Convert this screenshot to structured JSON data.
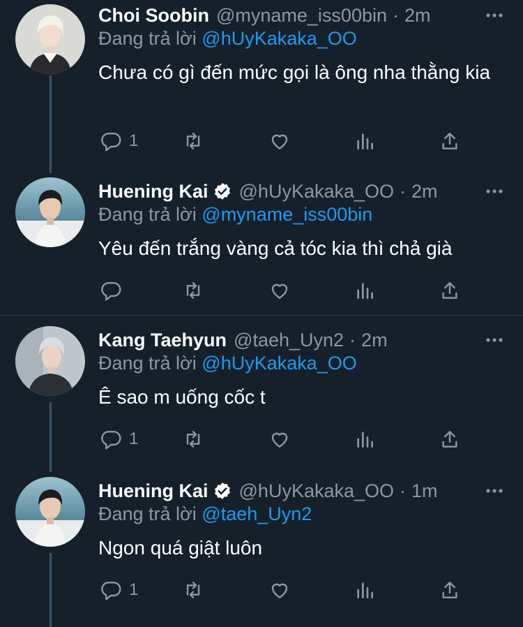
{
  "tweets": [
    {
      "name": "Choi Soobin",
      "verified": false,
      "handle": "@myname_iss00bin",
      "time": "2m",
      "reply_prefix": "Đang trả lời",
      "reply_to": "@hUyKakaka_OO",
      "text": "Chưa có gì đến mức gọi là ông nha thằng kia",
      "reply_count": "1",
      "avatar": "soobin-avatar"
    },
    {
      "name": "Huening Kai",
      "verified": true,
      "handle": "@hUyKakaka_OO",
      "time": "2m",
      "reply_prefix": "Đang trả lời",
      "reply_to": "@myname_iss00bin",
      "text": "Yêu đến trắng vàng cả tóc kia thì chả già",
      "reply_count": "",
      "avatar": "kai-avatar"
    },
    {
      "name": "Kang Taehyun",
      "verified": false,
      "handle": "@taeh_Uyn2",
      "time": "2m",
      "reply_prefix": "Đang trả lời",
      "reply_to": "@hUyKakaka_OO",
      "text": "Ê sao m uống cốc t",
      "reply_count": "1",
      "avatar": "taehyun-avatar"
    },
    {
      "name": "Huening Kai",
      "verified": true,
      "handle": "@hUyKakaka_OO",
      "time": "1m",
      "reply_prefix": "Đang trả lời",
      "reply_to": "@taeh_Uyn2",
      "text": "Ngon quá giật luôn",
      "reply_count": "1",
      "avatar": "kai-avatar"
    }
  ],
  "separator": "·",
  "colors": {
    "background": "#15202b",
    "secondary_text": "#8b98a5",
    "mention": "#1d9bf0",
    "verified": "#ffffff",
    "divider": "#38444d"
  },
  "icons": {
    "reply": "reply-icon",
    "retweet": "retweet-icon",
    "like": "heart-icon",
    "analytics": "analytics-icon",
    "share": "share-icon",
    "more": "more-icon"
  }
}
